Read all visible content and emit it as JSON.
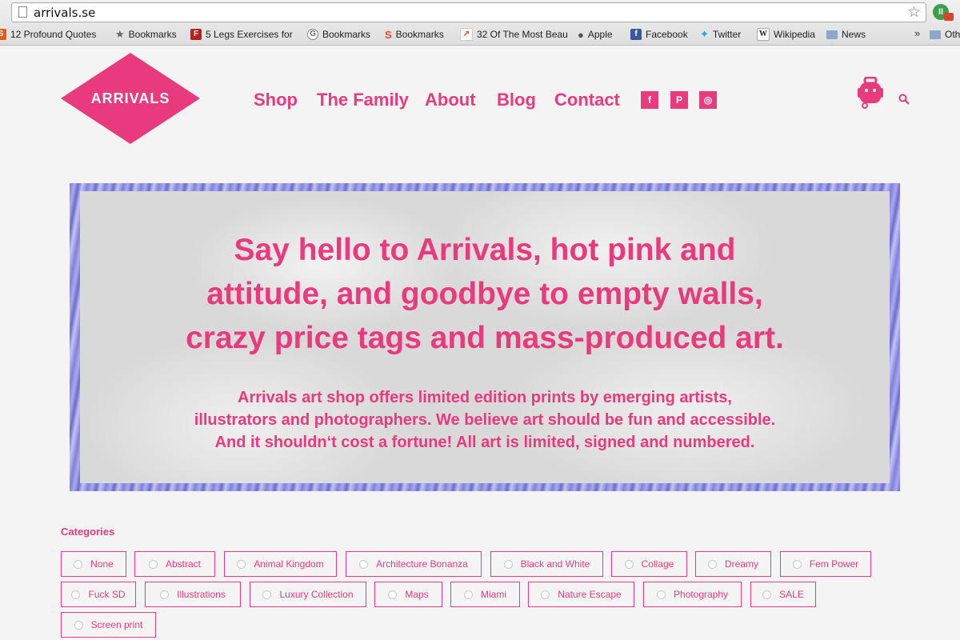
{
  "browser": {
    "url": "arrivals.se",
    "bookmarks": [
      {
        "label": "12 Profound Quotes",
        "icon": "s-icon",
        "color": "#e85a1a"
      },
      {
        "label": "Bookmarks",
        "icon": "star-icon",
        "color": "#666666"
      },
      {
        "label": "5 Legs Exercises for",
        "icon": "fitness-icon",
        "color": "#b22222"
      },
      {
        "label": "Bookmarks",
        "icon": "g-icon",
        "color": "#888888"
      },
      {
        "label": "Bookmarks",
        "icon": "swirl-icon",
        "color": "#e0442e"
      },
      {
        "label": "32 Of The Most Beau",
        "icon": "trend-icon",
        "color": "#e44d26"
      },
      {
        "label": "Apple",
        "icon": "apple-icon",
        "color": "#555555"
      },
      {
        "label": "Facebook",
        "icon": "facebook-icon",
        "color": "#3b5998"
      },
      {
        "label": "Twitter",
        "icon": "twitter-icon",
        "color": "#1da1f2"
      },
      {
        "label": "Wikipedia",
        "icon": "wikipedia-icon",
        "color": "#222222"
      },
      {
        "label": "News",
        "icon": "folder-icon",
        "color": "#8aa8c8"
      }
    ],
    "overflow_label": "»",
    "other_label": "Oth"
  },
  "site": {
    "logo_text": "ARRIVALS",
    "accent": "#e83a7c",
    "nav": [
      "Shop",
      "The Family",
      "About",
      "Blog",
      "Contact"
    ],
    "social": [
      {
        "glyph": "f",
        "icon": "facebook-icon"
      },
      {
        "glyph": "P",
        "icon": "pinterest-icon"
      },
      {
        "glyph": "◎",
        "icon": "instagram-icon"
      }
    ]
  },
  "hero": {
    "headline_lines": [
      "Say hello to Arrivals, hot pink and",
      "attitude, and goodbye to empty walls,",
      "crazy price tags and mass-produced art."
    ],
    "body_lines": [
      "Arrivals art shop offers limited edition prints by emerging artists,",
      "illustrators and photographers. We believe art should be fun and accessible.",
      "And it shouldn‘t cost a fortune! All art is limited, signed and numbered."
    ]
  },
  "categories": {
    "title": "Categories",
    "items": [
      "None",
      "Abstract",
      "Animal Kingdom",
      "Architecture Bonanza",
      "Black and White",
      "Collage",
      "Dreamy",
      "Fem Power",
      "Fuck SD",
      "Illustrations",
      "Luxury Collection",
      "Maps",
      "Miami",
      "Nature Escape",
      "Photography",
      "SALE",
      "Screen print"
    ]
  }
}
